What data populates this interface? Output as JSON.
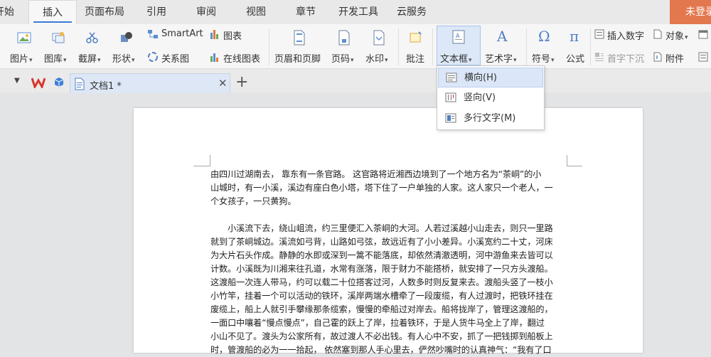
{
  "tabs": [
    {
      "label": "开始",
      "active": false
    },
    {
      "label": "插入",
      "active": true
    },
    {
      "label": "页面布局",
      "active": false
    },
    {
      "label": "引用",
      "active": false
    },
    {
      "label": "审阅",
      "active": false
    },
    {
      "label": "视图",
      "active": false
    },
    {
      "label": "章节",
      "active": false
    },
    {
      "label": "开发工具",
      "active": false
    },
    {
      "label": "云服务",
      "active": false
    }
  ],
  "login_label": "未登录",
  "ribbon": {
    "picture": "图片",
    "gallery": "图库",
    "screenshot": "截屏",
    "shape": "形状",
    "smartart": "SmartArt",
    "relation": "关系图",
    "chart": "图表",
    "online_chart": "在线图表",
    "header_footer": "页眉和页脚",
    "page_number": "页码",
    "watermark": "水印",
    "comment": "批注",
    "textbox": "文本框",
    "wordart": "艺术字",
    "symbol": "符号",
    "formula": "公式",
    "insert_number": "插入数字",
    "object": "对象",
    "drop_cap": "首字下沉",
    "attachment": "附件"
  },
  "document_tab": {
    "title": "文档1 *"
  },
  "textbox_menu": [
    {
      "label": "横向(H)",
      "highlighted": true
    },
    {
      "label": "竖向(V)",
      "highlighted": false
    },
    {
      "label": "多行文字(M)",
      "highlighted": false
    }
  ],
  "document": {
    "para1": [
      "由四川过湖南去， 靠东有一条官路。 这官路将近湘西边境到了一个地方名为“茶峒”的小",
      "山城时，有一小溪，溪边有座白色小塔，塔下住了一户单独的人家。这人家只一个老人，一",
      "个女孩子，一只黄狗。"
    ],
    "para2": [
      "　　小溪流下去，绕山岨流，约三里便汇入茶峒的大河。人若过溪越小山走去，则只一里路",
      "就到了茶峒城边。溪流如弓背，山路如弓弦，故远近有了小小差异。小溪宽约二十丈，河床",
      "为大片石头作成。静静的水即或深到一篙不能落底，却依然清澈透明，河中游鱼来去皆可以",
      "计数。小溪既为川湘来往孔道，水常有涨落，限于财力不能搭桥，就安排了一只方头渡船。",
      "这渡船一次连人带马，约可以载二十位搭客过河，人数多时则反复来去。渡船头竖了一枝小",
      "小竹竿，挂着一个可以活动的铁环，溪岸两端水槽牵了一段废缆，有人过渡时，把铁环挂在",
      "废缆上，船上人就引手攀缘那条缆索，慢慢的牵船过对岸去。船将拢岸了，管理这渡船的，",
      "一面口中嚷着“慢点慢点”，自己霍的跃上了岸，拉着铁环，于是人货牛马全上了岸，翻过",
      "小山不见了。渡头为公家所有，故过渡人不必出钱。有人心中不安，抓了一把钱掷到船板上",
      "时，管渡船的必为一一拾起， 依然塞到那人手心里去，俨然吵嘴时的认真神气：“我有了口"
    ]
  }
}
